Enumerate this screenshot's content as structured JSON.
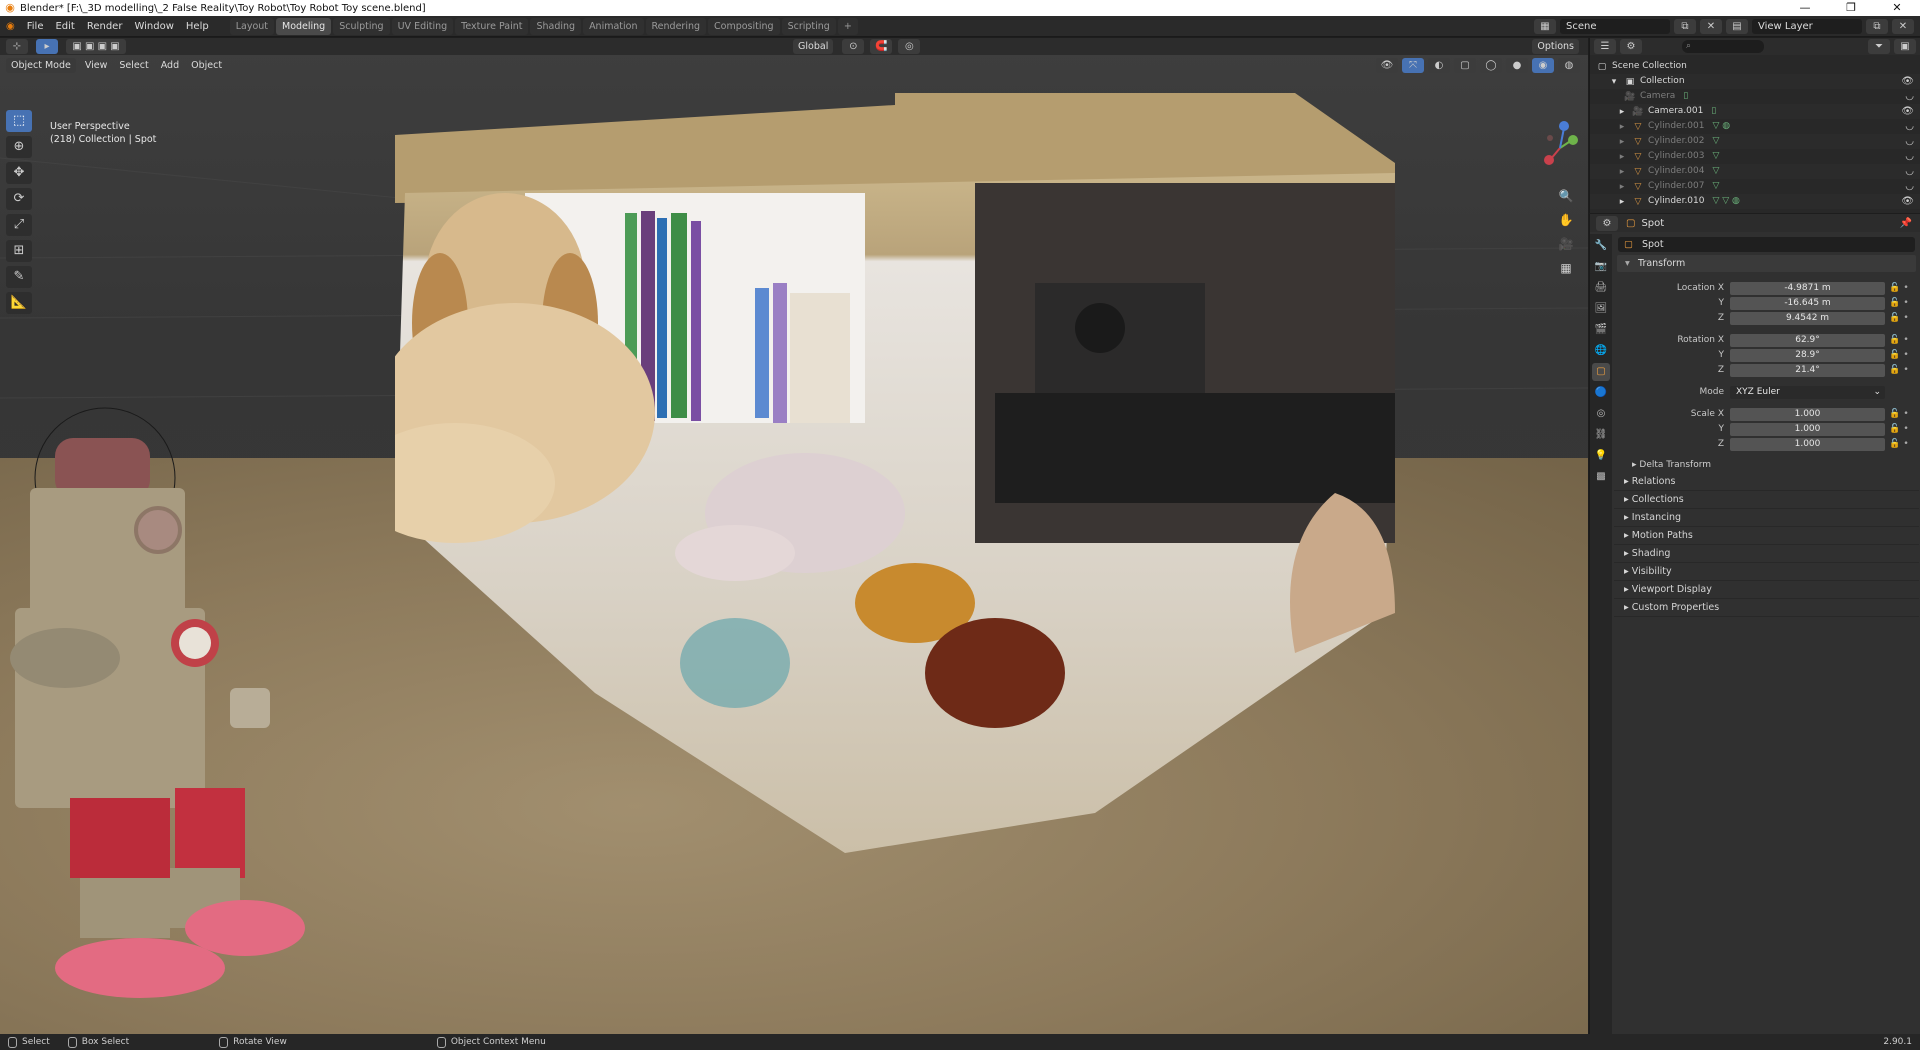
{
  "window": {
    "title": "Blender* [F:\\_3D modelling\\_2 False Reality\\Toy Robot\\Toy Robot Toy scene.blend]",
    "controls": [
      "—",
      "❐",
      "✕"
    ]
  },
  "menu": {
    "items": [
      "File",
      "Edit",
      "Render",
      "Window",
      "Help"
    ]
  },
  "workspaces": {
    "tabs": [
      "Layout",
      "Modeling",
      "Sculpting",
      "UV Editing",
      "Texture Paint",
      "Shading",
      "Animation",
      "Rendering",
      "Compositing",
      "Scripting"
    ],
    "active": "Modeling",
    "add": "+"
  },
  "scene": {
    "scene_name": "Scene",
    "view_layer": "View Layer"
  },
  "viewport_header": {
    "mode": "Object Mode",
    "menus": [
      "View",
      "Select",
      "Add",
      "Object"
    ],
    "transform_orientation": "Global",
    "options": "Options"
  },
  "viewport": {
    "perspective": "User Perspective",
    "context": "(218) Collection | Spot"
  },
  "outliner": {
    "root": "Scene Collection",
    "rows": [
      {
        "name": "Collection",
        "icon": "collection-icon",
        "dim": false
      },
      {
        "name": "Camera",
        "icon": "camera-icon",
        "dim": true
      },
      {
        "name": "Camera.001",
        "icon": "camera-icon",
        "dim": false
      },
      {
        "name": "Cylinder.001",
        "icon": "mesh-icon",
        "dim": true
      },
      {
        "name": "Cylinder.002",
        "icon": "mesh-icon",
        "dim": true
      },
      {
        "name": "Cylinder.003",
        "icon": "mesh-icon",
        "dim": true
      },
      {
        "name": "Cylinder.004",
        "icon": "mesh-icon",
        "dim": true
      },
      {
        "name": "Cylinder.007",
        "icon": "mesh-icon",
        "dim": true
      },
      {
        "name": "Cylinder.010",
        "icon": "mesh-icon",
        "dim": false
      }
    ]
  },
  "properties": {
    "header_object": "Spot",
    "object_name": "Spot",
    "transform_title": "Transform",
    "location_label": "Location X",
    "location": [
      "-4.9871 m",
      "-16.645 m",
      "9.4542 m"
    ],
    "rotation_label": "Rotation X",
    "rotation": [
      "62.9°",
      "28.9°",
      "21.4°"
    ],
    "mode_label": "Mode",
    "mode_value": "XYZ Euler",
    "scale_label": "Scale X",
    "scale": [
      "1.000",
      "1.000",
      "1.000"
    ],
    "axis_y": "Y",
    "axis_z": "Z",
    "delta_transform": "Delta Transform",
    "panels": [
      "Relations",
      "Collections",
      "Instancing",
      "Motion Paths",
      "Shading",
      "Visibility",
      "Viewport Display",
      "Custom Properties"
    ]
  },
  "statusbar": {
    "select": "Select",
    "box_select": "Box Select",
    "rotate_view": "Rotate View",
    "context_menu": "Object Context Menu",
    "version": "2.90.1"
  },
  "colors": {
    "accent": "#4772b3",
    "orange": "#e87d0d"
  }
}
